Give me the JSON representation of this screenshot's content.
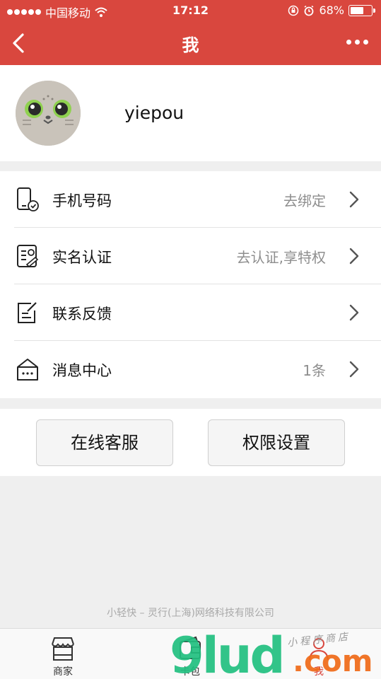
{
  "status_bar": {
    "carrier": "中国移动",
    "time": "17:12",
    "battery_percent": "68%",
    "battery_level": 0.68
  },
  "navbar": {
    "title": "我",
    "back_icon": "chevron-left-icon",
    "more_icon": "more-dots-icon"
  },
  "profile": {
    "username": "yiepou"
  },
  "menu": {
    "items": [
      {
        "label": "手机号码",
        "value": "去绑定",
        "icon": "phone-check-icon"
      },
      {
        "label": "实名认证",
        "value": "去认证,享特权",
        "icon": "id-card-icon"
      },
      {
        "label": "联系反馈",
        "value": "",
        "icon": "edit-note-icon"
      },
      {
        "label": "消息中心",
        "value": "1条",
        "icon": "message-box-icon"
      }
    ]
  },
  "actions": {
    "online_service": "在线客服",
    "permission_settings": "权限设置"
  },
  "footer": {
    "company": "小轻快 – 灵行(上海)网络科技有限公司"
  },
  "tabbar": {
    "tabs": [
      {
        "label": "商家",
        "icon": "store-icon"
      },
      {
        "label": "卡包",
        "icon": "wallet-icon"
      },
      {
        "label": "我",
        "icon": "person-icon"
      }
    ]
  },
  "watermark": {
    "main": "9lud",
    "suffix": ".com",
    "tagline": "小程序商店"
  },
  "colors": {
    "brand_red": "#d9473e",
    "page_bg": "#efefef"
  }
}
